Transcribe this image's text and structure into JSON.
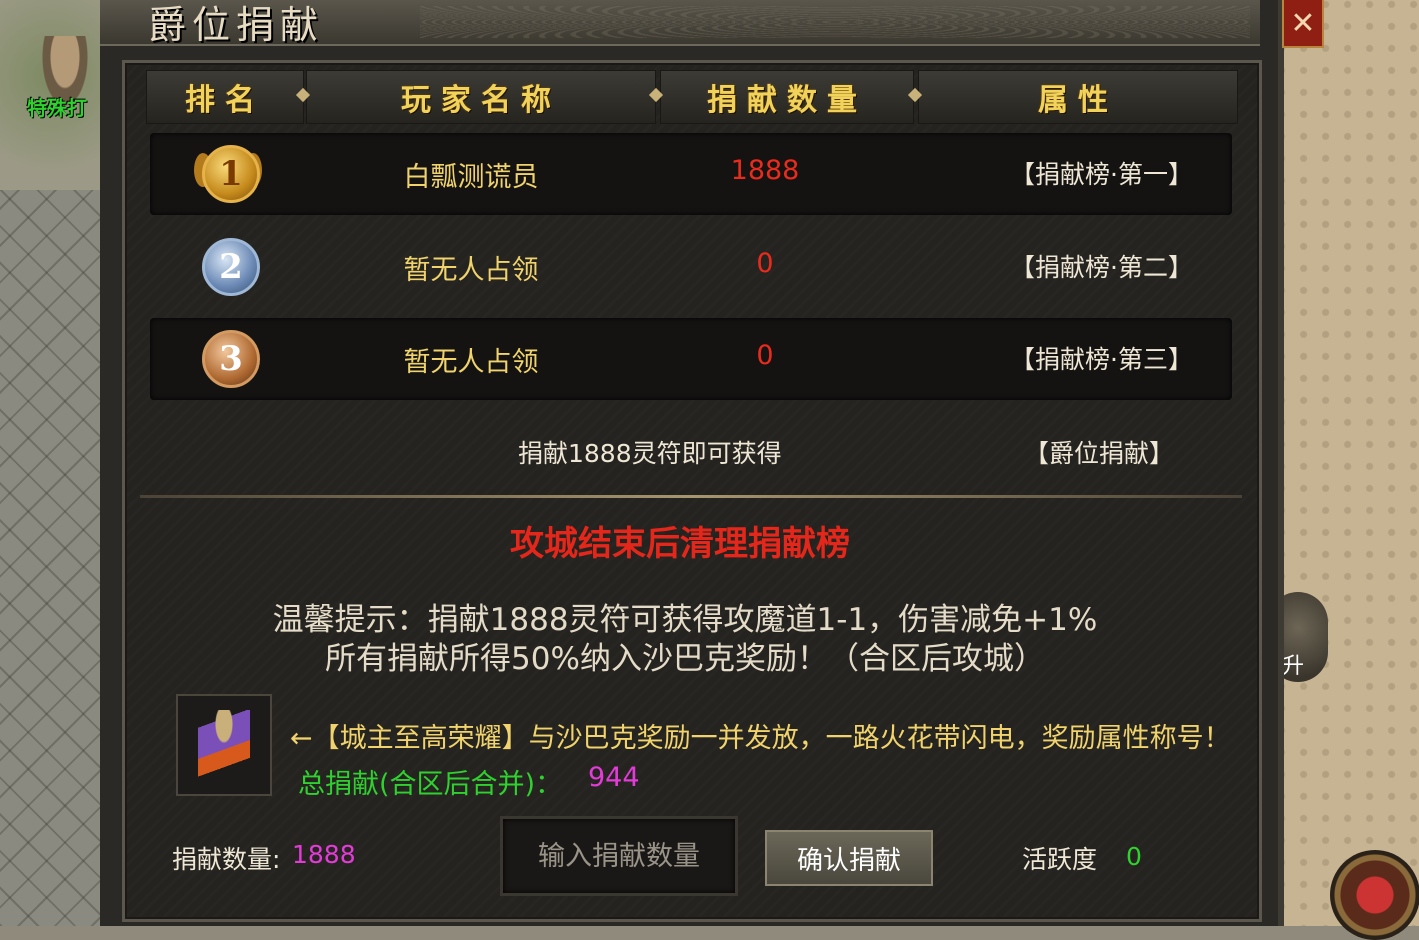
{
  "window": {
    "title": "爵位捐献",
    "close_label": "✕"
  },
  "scene": {
    "npc_label": "特殊打",
    "side_button_label": "升"
  },
  "table": {
    "headers": [
      "排名",
      "玩家名称",
      "捐献数量",
      "属性"
    ],
    "rows": [
      {
        "rank": "1",
        "player": "白瓢测谎员",
        "amount": "1888",
        "attr": "【捐献榜·第一】"
      },
      {
        "rank": "2",
        "player": "暂无人占领",
        "amount": "0",
        "attr": "【捐献榜·第二】"
      },
      {
        "rank": "3",
        "player": "暂无人占领",
        "amount": "0",
        "attr": "【捐献榜·第三】"
      }
    ],
    "info": {
      "text": "捐献1888灵符即可获得",
      "attr": "【爵位捐献】"
    }
  },
  "notice": {
    "warning": "攻城结束后清理捐献榜",
    "tip_line1": "温馨提示：捐献1888灵符可获得攻魔道1-1，伤害减免+1%",
    "tip_line2": "所有捐献所得50%纳入沙巴克奖励！（合区后攻城）"
  },
  "reward": {
    "text": "←【城主至高荣耀】与沙巴克奖励一并发放，一路火花带闪电，奖励属性称号！",
    "total_label": "总捐献(合区后合并)：",
    "total_value": "944"
  },
  "footer": {
    "donate_label": "捐献数量:",
    "donate_value": "1888",
    "input_placeholder": "输入捐献数量",
    "confirm_label": "确认捐献",
    "activity_label": "活跃度",
    "activity_value": "0"
  },
  "colors": {
    "gold_text": "#f0d36c",
    "red_text": "#e82b1c",
    "green_text": "#2fd12f",
    "magenta_text": "#e23bd8",
    "header_text": "#f1d25a"
  }
}
